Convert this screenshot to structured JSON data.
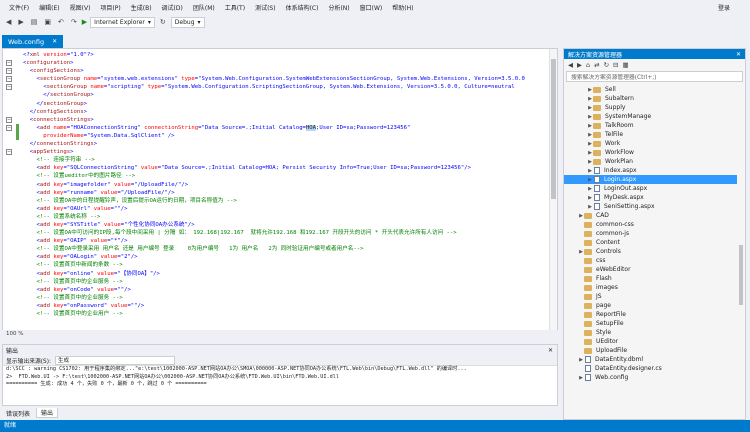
{
  "menu": [
    "文件(F)",
    "编辑(E)",
    "视图(V)",
    "项目(P)",
    "生成(B)",
    "调试(D)",
    "团队(M)",
    "工具(T)",
    "测试(S)",
    "体系结构(C)",
    "分析(N)",
    "窗口(W)",
    "帮助(H)"
  ],
  "login": "登录",
  "toolbar": {
    "browser": "Internet Explorer",
    "config": "Debug"
  },
  "doc_tab": "Web.config",
  "code_lines": [
    [
      [
        "c-b",
        "<?"
      ],
      [
        "c-t",
        "xml"
      ],
      [
        "c-a",
        " version"
      ],
      [
        "c-b",
        "=\"1.0\"?>"
      ]
    ],
    [
      [
        "c-b",
        "<"
      ],
      [
        "c-t",
        "configuration"
      ],
      [
        "c-b",
        ">"
      ]
    ],
    [
      [
        "c-b",
        "  <"
      ],
      [
        "c-t",
        "configSections"
      ],
      [
        "c-b",
        ">"
      ]
    ],
    [
      [
        "c-b",
        "    <"
      ],
      [
        "c-t",
        "sectionGroup"
      ],
      [
        "c-a",
        " name"
      ],
      [
        "c-b",
        "=\"system.web.extensions\""
      ],
      [
        "c-a",
        " type"
      ],
      [
        "c-b",
        "=\"System.Web.Configuration.SystemWebExtensionsSectionGroup, System.Web.Extensions, Version=3.5.0.0"
      ]
    ],
    [
      [
        "c-b",
        "      <"
      ],
      [
        "c-t",
        "sectionGroup"
      ],
      [
        "c-a",
        " name"
      ],
      [
        "c-b",
        "=\"scripting\""
      ],
      [
        "c-a",
        " type"
      ],
      [
        "c-b",
        "=\"System.Web.Configuration.ScriptingSectionGroup, System.Web.Extensions, Version=3.5.0.0, Culture=neutral"
      ]
    ],
    [
      [
        "c-b",
        "      </"
      ],
      [
        "c-t",
        "sectionGroup"
      ],
      [
        "c-b",
        ">"
      ]
    ],
    [
      [
        "c-b",
        "    </"
      ],
      [
        "c-t",
        "sectionGroup"
      ],
      [
        "c-b",
        ">"
      ]
    ],
    [
      [
        "c-b",
        "  </"
      ],
      [
        "c-t",
        "configSections"
      ],
      [
        "c-b",
        ">"
      ]
    ],
    [
      [
        "c-b",
        "  <"
      ],
      [
        "c-t",
        "connectionStrings"
      ],
      [
        "c-b",
        ">"
      ]
    ],
    [
      [
        "c-b",
        "    <"
      ],
      [
        "c-t",
        "add"
      ],
      [
        "c-a",
        " name"
      ],
      [
        "c-b",
        "=\"HOAConnectionString\""
      ],
      [
        "c-a",
        " connectionString"
      ],
      [
        "c-b",
        "=\"Data Source=.;Initial Catalog="
      ],
      [
        "c-hl",
        "HOA"
      ],
      [
        "c-b",
        ";User ID=sa;Password=123456\""
      ]
    ],
    [
      [
        "c-a",
        "      providerName"
      ],
      [
        "c-b",
        "=\"System.Data.SqlClient\" />"
      ]
    ],
    [
      [
        "c-b",
        "  </"
      ],
      [
        "c-t",
        "connectionStrings"
      ],
      [
        "c-b",
        ">"
      ]
    ],
    [
      [
        "c-b",
        "  <"
      ],
      [
        "c-t",
        "appSettings"
      ],
      [
        "c-b",
        ">"
      ]
    ],
    [
      [
        "c-c",
        "    <!-- 连接字符串 -->"
      ]
    ],
    [
      [
        "c-b",
        "    <"
      ],
      [
        "c-t",
        "add"
      ],
      [
        "c-a",
        " key"
      ],
      [
        "c-b",
        "=\"SQLConnectionString\""
      ],
      [
        "c-a",
        " value"
      ],
      [
        "c-b",
        "=\"Data Source=.;Initial Catalog=HOA; Persist Security Info=True;User ID=sa;Password=123456\"/>"
      ]
    ],
    [
      [
        "c-c",
        "    <!-- 设置ueditor中的图片路径 -->"
      ]
    ],
    [
      [
        "c-b",
        "    <"
      ],
      [
        "c-t",
        "add"
      ],
      [
        "c-a",
        " key"
      ],
      [
        "c-b",
        "=\"imagefolder\""
      ],
      [
        "c-a",
        " value"
      ],
      [
        "c-b",
        "=\"/UploadFile/\"/>"
      ]
    ],
    [
      [
        "c-b",
        "    <"
      ],
      [
        "c-t",
        "add"
      ],
      [
        "c-a",
        " key"
      ],
      [
        "c-b",
        "=\"runname\""
      ],
      [
        "c-a",
        " value"
      ],
      [
        "c-b",
        "=\"/UploadFile/\"/>"
      ]
    ],
    [
      [
        "c-c",
        "    <!-- 设置OA中的日程提醒铃声，设置后提示OA运行的日期，项目名称值为 -->"
      ]
    ],
    [
      [
        "c-b",
        "    <"
      ],
      [
        "c-t",
        "add"
      ],
      [
        "c-a",
        " key"
      ],
      [
        "c-b",
        "=\"OAUrl\""
      ],
      [
        "c-a",
        " value"
      ],
      [
        "c-b",
        "=\"\"/>"
      ]
    ],
    [
      [
        "c-c",
        "    <!-- 设置系统名称 -->"
      ]
    ],
    [
      [
        "c-b",
        "    <"
      ],
      [
        "c-t",
        "add"
      ],
      [
        "c-a",
        " key"
      ],
      [
        "c-b",
        "=\"SYSTitle\""
      ],
      [
        "c-a",
        " value"
      ],
      [
        "c-b",
        "=\"个性化协同OA办公系统\"/>"
      ]
    ],
    [
      [
        "c-c",
        "    <!-- 设置OA中可访问的IP段,每个段中间采用 | 分隔 如： 192.168|192.167  就将允许192.168 和192.167 开段开头的访问 * 开头代表允许所有人访问 -->"
      ]
    ],
    [
      [
        "c-b",
        "    <"
      ],
      [
        "c-t",
        "add"
      ],
      [
        "c-a",
        " key"
      ],
      [
        "c-b",
        "=\"OAIP\""
      ],
      [
        "c-a",
        " value"
      ],
      [
        "c-b",
        "=\"*\"/>"
      ]
    ],
    [
      [
        "c-c",
        "    <!-- 设置OA中登录采用 用户名 还是 用户编号 登录    0为用户编号   1为 用户名   2为 同时验证用户编号或者用户名--> "
      ]
    ],
    [
      [
        "c-b",
        "    <"
      ],
      [
        "c-t",
        "add"
      ],
      [
        "c-a",
        " key"
      ],
      [
        "c-b",
        "=\"OALogin\""
      ],
      [
        "c-a",
        " value"
      ],
      [
        "c-b",
        "=\"2\"/>"
      ]
    ],
    [
      [
        "c-c",
        "    <!-- 设置首页中新闻的条数 -->"
      ]
    ],
    [
      [
        "c-b",
        "    <"
      ],
      [
        "c-t",
        "add"
      ],
      [
        "c-a",
        " key"
      ],
      [
        "c-b",
        "=\"online\""
      ],
      [
        "c-a",
        " value"
      ],
      [
        "c-b",
        "=\"【协同OA】\"/>"
      ]
    ],
    [
      [
        "c-c",
        "    <!-- 设置首页中的企业服务 -->"
      ]
    ],
    [
      [
        "c-b",
        "    <"
      ],
      [
        "c-t",
        "add"
      ],
      [
        "c-a",
        " key"
      ],
      [
        "c-b",
        "=\"onCode\""
      ],
      [
        "c-a",
        " value"
      ],
      [
        "c-b",
        "=\"\"/>"
      ]
    ],
    [
      [
        "c-c",
        "    <!-- 设置首页中的企业服务 -->"
      ]
    ],
    [
      [
        "c-b",
        "    <"
      ],
      [
        "c-t",
        "add"
      ],
      [
        "c-a",
        " key"
      ],
      [
        "c-b",
        "=\"onPassword\""
      ],
      [
        "c-a",
        " value"
      ],
      [
        "c-b",
        "=\"\"/>"
      ]
    ],
    [
      [
        "c-c",
        "    <!-- 设置首页中的企业用户 -->"
      ]
    ]
  ],
  "zoom": "100 %",
  "output": {
    "title": "输出",
    "source_label": "显示输出来源(S):",
    "source_value": "生成",
    "lines": [
      "d:\\SCC : warning CS1702: 用于程序集的绑定...\"e:\\test\\1002000-ASP.NET网站OA办公\\SMOA\\000000-ASP.NET协同OA办公系统\\FTL.Web\\bin\\Debug\\FTL.Web.dll\" 的编译时...",
      "2>  FTD.Web.UI -> F:\\test\\1002000-ASP.NET网站OA办公\\002000-ASP.NET协同OA办公系统\\FTD.Web.UI\\bin\\FTD.Web.UI.dll",
      "========== 生成: 成功 4 个，失败 0 个，最新 0 个，跳过 0 个 =========="
    ]
  },
  "bottom_tabs": [
    "错误列表",
    "输出"
  ],
  "status": "就绪",
  "solution_explorer": {
    "title": "解决方案资源管理器",
    "search_placeholder": "搜索解决方案资源管理器(Ctrl+;)",
    "items": [
      {
        "type": "folder",
        "label": "Sell",
        "indent": 1,
        "arrow": "▶"
      },
      {
        "type": "folder",
        "label": "Subaltern",
        "indent": 1,
        "arrow": "▶"
      },
      {
        "type": "folder",
        "label": "Supply",
        "indent": 1,
        "arrow": "▶"
      },
      {
        "type": "folder",
        "label": "SystemManage",
        "indent": 1,
        "arrow": "▶"
      },
      {
        "type": "folder",
        "label": "TalkRoom",
        "indent": 1,
        "arrow": "▶"
      },
      {
        "type": "folder",
        "label": "TelFile",
        "indent": 1,
        "arrow": "▶"
      },
      {
        "type": "folder",
        "label": "Work",
        "indent": 1,
        "arrow": "▶"
      },
      {
        "type": "folder",
        "label": "WorkFlow",
        "indent": 1,
        "arrow": "▶"
      },
      {
        "type": "folder",
        "label": "WorkPlan",
        "indent": 1,
        "arrow": "▶"
      },
      {
        "type": "file",
        "label": "Index.aspx",
        "indent": 1,
        "arrow": "▶"
      },
      {
        "type": "file",
        "label": "Login.aspx",
        "indent": 1,
        "arrow": "▶",
        "selected": true
      },
      {
        "type": "file",
        "label": "LoginOut.aspx",
        "indent": 1,
        "arrow": "▶"
      },
      {
        "type": "file",
        "label": "MyDesk.aspx",
        "indent": 1,
        "arrow": "▶"
      },
      {
        "type": "file",
        "label": "SeniSetting.aspx",
        "indent": 1,
        "arrow": "▶"
      },
      {
        "type": "folder",
        "label": "CAD",
        "indent": 0,
        "arrow": "▶"
      },
      {
        "type": "folder",
        "label": "common-css",
        "indent": 0,
        "arrow": ""
      },
      {
        "type": "folder",
        "label": "common-js",
        "indent": 0,
        "arrow": ""
      },
      {
        "type": "folder",
        "label": "Content",
        "indent": 0,
        "arrow": ""
      },
      {
        "type": "folder",
        "label": "Controls",
        "indent": 0,
        "arrow": "▶"
      },
      {
        "type": "folder",
        "label": "css",
        "indent": 0,
        "arrow": ""
      },
      {
        "type": "folder",
        "label": "eWebEditor",
        "indent": 0,
        "arrow": ""
      },
      {
        "type": "folder",
        "label": "Flash",
        "indent": 0,
        "arrow": ""
      },
      {
        "type": "folder",
        "label": "images",
        "indent": 0,
        "arrow": ""
      },
      {
        "type": "folder",
        "label": "JS",
        "indent": 0,
        "arrow": ""
      },
      {
        "type": "folder",
        "label": "page",
        "indent": 0,
        "arrow": ""
      },
      {
        "type": "folder",
        "label": "ReportFile",
        "indent": 0,
        "arrow": ""
      },
      {
        "type": "folder",
        "label": "SetupFile",
        "indent": 0,
        "arrow": ""
      },
      {
        "type": "folder",
        "label": "Style",
        "indent": 0,
        "arrow": ""
      },
      {
        "type": "folder",
        "label": "UEditor",
        "indent": 0,
        "arrow": ""
      },
      {
        "type": "folder",
        "label": "UploadFile",
        "indent": 0,
        "arrow": ""
      },
      {
        "type": "file",
        "label": "DataEntity.dbml",
        "indent": 0,
        "arrow": "▶"
      },
      {
        "type": "file",
        "label": "DataEntity.designer.cs",
        "indent": 0,
        "arrow": ""
      },
      {
        "type": "file",
        "label": "Web.config",
        "indent": 0,
        "arrow": "▶"
      }
    ]
  }
}
